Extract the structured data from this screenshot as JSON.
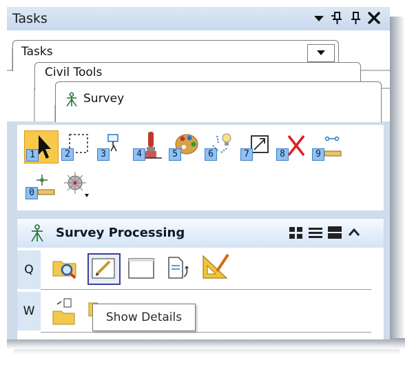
{
  "window": {
    "title": "Tasks"
  },
  "titlebar_controls": [
    {
      "name": "dropdown-menu-icon"
    },
    {
      "name": "dock-pin-icon"
    },
    {
      "name": "autohide-pin-icon"
    },
    {
      "name": "close-icon"
    }
  ],
  "tabs": [
    {
      "label": "Tasks"
    },
    {
      "label": "Civil Tools"
    },
    {
      "label": "Survey",
      "icon": "survey-tripod-icon"
    }
  ],
  "tools": [
    {
      "number": "1",
      "icon": "select-arrow-icon",
      "selected": true
    },
    {
      "number": "2",
      "icon": "selection-rectangle-icon"
    },
    {
      "number": "3",
      "icon": "place-element-icon"
    },
    {
      "number": "4",
      "icon": "paintbrush-icon"
    },
    {
      "number": "5",
      "icon": "palette-icon"
    },
    {
      "number": "6",
      "icon": "highlight-bulb-icon"
    },
    {
      "number": "7",
      "icon": "fit-view-icon"
    },
    {
      "number": "8",
      "icon": "delete-x-icon"
    },
    {
      "number": "9",
      "icon": "measure-distance-icon"
    },
    {
      "number": "0",
      "icon": "measure-point-icon"
    },
    {
      "number": "",
      "icon": "snap-target-icon"
    }
  ],
  "survey_processing": {
    "title": "Survey Processing",
    "header_icon": "survey-tripod-icon",
    "view_controls": [
      "grid-view-icon",
      "list-view-icon",
      "detail-view-icon",
      "collapse-chevron-icon"
    ],
    "rows": [
      {
        "letter": "Q",
        "icons": [
          "search-folder-icon",
          "edit-pencil-icon",
          "blank-window-icon",
          "import-document-icon",
          "triangle-ruler-icon"
        ]
      },
      {
        "letter": "W",
        "icons": [
          "open-folder-icon",
          "folder-icon"
        ]
      }
    ]
  },
  "tooltip": {
    "text": "Show Details"
  }
}
